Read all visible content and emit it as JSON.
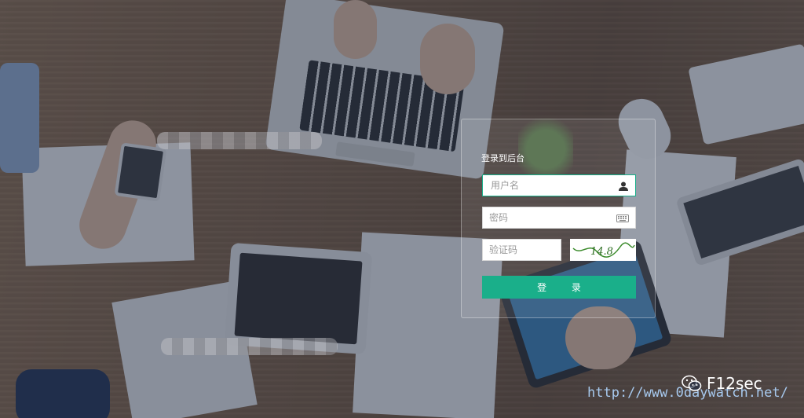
{
  "login": {
    "title": "登录到后台",
    "username_placeholder": "用户名",
    "password_placeholder": "密码",
    "captcha_placeholder": "验证码",
    "captcha_text": "14.8",
    "submit_label": "登 录"
  },
  "watermark": {
    "brand": "F12sec",
    "url": "http://www.0daywatch.net/"
  },
  "colors": {
    "accent": "#1aaf8a",
    "overlay": "#1e2d46"
  },
  "icons": {
    "username": "user-icon",
    "password": "keyboard-icon",
    "wechat": "wechat-icon"
  }
}
